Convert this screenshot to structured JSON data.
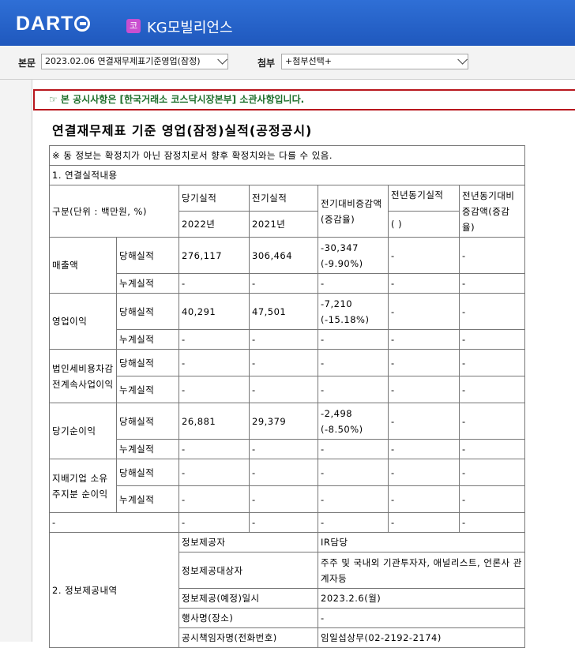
{
  "header": {
    "logo_text": "DART",
    "corp_badge": "코",
    "corp_name": "KG모빌리언스"
  },
  "toolbar": {
    "main_label": "본문",
    "main_select_value": "2023.02.06  연결재무제표기준영업(잠정)",
    "attach_label": "첨부",
    "attach_select_value": "+첨부선택+"
  },
  "notice": "☞ 본 공시사항은 [한국거래소 코스닥시장본부] 소관사항입니다.",
  "doc_title": "연결재무제표 기준 영업(잠정)실적(공정공시)",
  "table": {
    "disclaimer": "※ 동 정보는 확정치가 아닌 잠정치로서 향후 확정치와는 다를 수 있음.",
    "section1": "1. 연결실적내용",
    "header": {
      "category": "구분(단위 : 백만원, %)",
      "current": "당기실적",
      "previous": "전기실적",
      "change": "전기대비증감액(증감율)",
      "yoy": "전년동기실적",
      "yoy_change": "전년동기대비증감액(증감율)",
      "current_year": "2022년",
      "previous_year": "2021년",
      "yoy_year": "(  )"
    },
    "labels": {
      "quarter": "당해실적",
      "cumulative": "누계실적"
    },
    "rows": [
      {
        "name": "매출액",
        "current": "276,117",
        "previous": "306,464",
        "change": "-30,347",
        "rate": "(-9.90%)",
        "yoy": "-",
        "yoy_change": "-"
      },
      {
        "name": "영업이익",
        "current": "40,291",
        "previous": "47,501",
        "change": "-7,210",
        "rate": "(-15.18%)",
        "yoy": "-",
        "yoy_change": "-"
      },
      {
        "name": "법인세비용차감전계속사업이익",
        "current": "-",
        "previous": "-",
        "change": "-",
        "rate": "",
        "yoy": "-",
        "yoy_change": "-"
      },
      {
        "name": "당기순이익",
        "current": "26,881",
        "previous": "29,379",
        "change": "-2,498",
        "rate": "(-8.50%)",
        "yoy": "-",
        "yoy_change": "-"
      },
      {
        "name": "지배기업 소유주지분 순이익",
        "current": "-",
        "previous": "-",
        "change": "-",
        "rate": "",
        "yoy": "-",
        "yoy_change": "-"
      }
    ],
    "cumulative_values": "-",
    "extra_row": "-",
    "section2": "2. 정보제공내역",
    "info": [
      {
        "label": "정보제공자",
        "value": "IR담당"
      },
      {
        "label": "정보제공대상자",
        "value": "주주 및 국내외 기관투자자, 애널리스트, 언론사 관계자등"
      },
      {
        "label": "정보제공(예정)일시",
        "value": "2023.2.6(월)"
      },
      {
        "label": "행사명(장소)",
        "value": "-"
      },
      {
        "label": "공시책임자명(전화번호)",
        "value": "임일섭상무(02-2192-2174)"
      }
    ]
  }
}
